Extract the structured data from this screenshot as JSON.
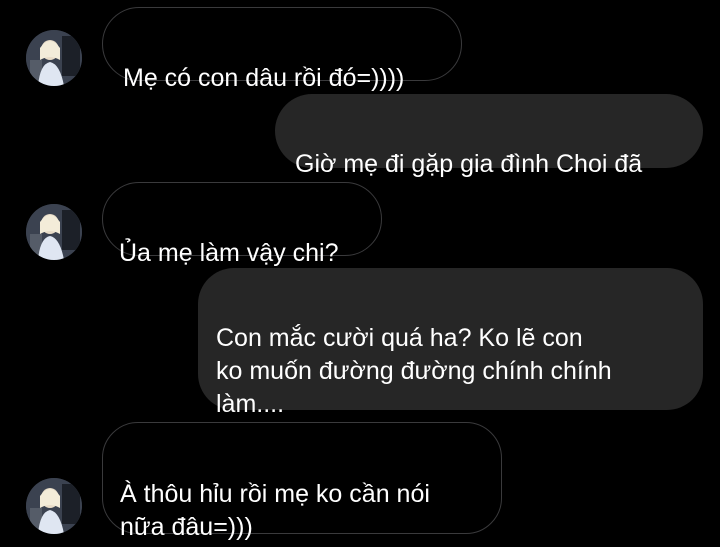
{
  "conversation": {
    "messages": [
      {
        "direction": "incoming",
        "text": "Mẹ có con dâu rồi đó=))))"
      },
      {
        "direction": "outgoing",
        "text": "Giờ mẹ đi gặp gia đình Choi đã"
      },
      {
        "direction": "incoming",
        "text": "Ủa mẹ làm vậy chi?"
      },
      {
        "direction": "outgoing",
        "text": "Con mắc cười quá ha? Ko lẽ con\nko muốn đường đường chính chính\nlàm...."
      },
      {
        "direction": "incoming",
        "text": "À thôu hỉu rồi mẹ ko cần nói\nnữa đâu=)))"
      }
    ]
  },
  "colors": {
    "background": "#000000",
    "incoming_border": "#3a3a3c",
    "outgoing_bubble": "#262626",
    "text": "#ffffff"
  }
}
